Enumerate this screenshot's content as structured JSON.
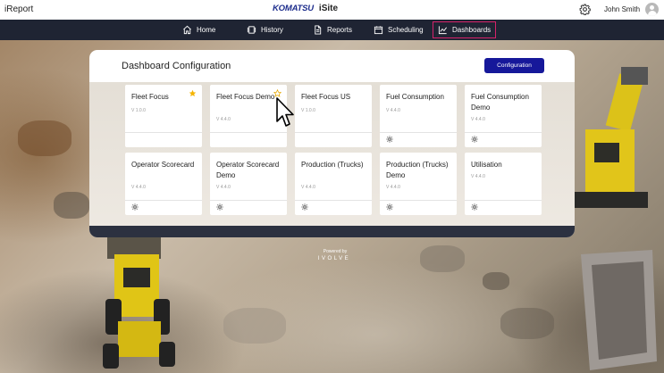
{
  "header": {
    "app_name": "iReport",
    "brand_logo": "KOMATSU",
    "brand_name": "iSite",
    "user_name": "John Smith",
    "icons": [
      "gear-icon",
      "avatar-icon"
    ]
  },
  "nav": {
    "items": [
      {
        "label": "Home",
        "icon": "home-icon"
      },
      {
        "label": "History",
        "icon": "history-icon"
      },
      {
        "label": "Reports",
        "icon": "reports-icon"
      },
      {
        "label": "Scheduling",
        "icon": "calendar-icon"
      },
      {
        "label": "Dashboards",
        "icon": "chart-icon",
        "active": true
      }
    ]
  },
  "panel": {
    "title": "Dashboard Configuration",
    "config_button": "Configuration",
    "cards": [
      {
        "title": "Fleet Focus",
        "version": "V 1.0.0",
        "favorite": true
      },
      {
        "title": "Fleet Focus Demo",
        "version": "V 4.4.0",
        "favorite": false
      },
      {
        "title": "Fleet Focus US",
        "version": "V 1.0.0"
      },
      {
        "title": "Fuel Consumption",
        "version": "V 4.4.0"
      },
      {
        "title": "Fuel Consumption Demo",
        "version": "V 4.4.0"
      },
      {
        "title": "Operator Scorecard",
        "version": "V 4.4.0"
      },
      {
        "title": "Operator Scorecard Demo",
        "version": "V 4.4.0"
      },
      {
        "title": "Production (Trucks)",
        "version": "V 4.4.0"
      },
      {
        "title": "Production (Trucks) Demo",
        "version": "V 4.4.0"
      },
      {
        "title": "Utilisation",
        "version": "V 4.4.0"
      }
    ]
  },
  "footer": {
    "powered_by": "Powered by",
    "logo_text": "IVOLVE"
  },
  "colors": {
    "nav_bg": "#1f2433",
    "accent": "#d6226a",
    "button": "#16189a",
    "star": "#f5b400"
  }
}
